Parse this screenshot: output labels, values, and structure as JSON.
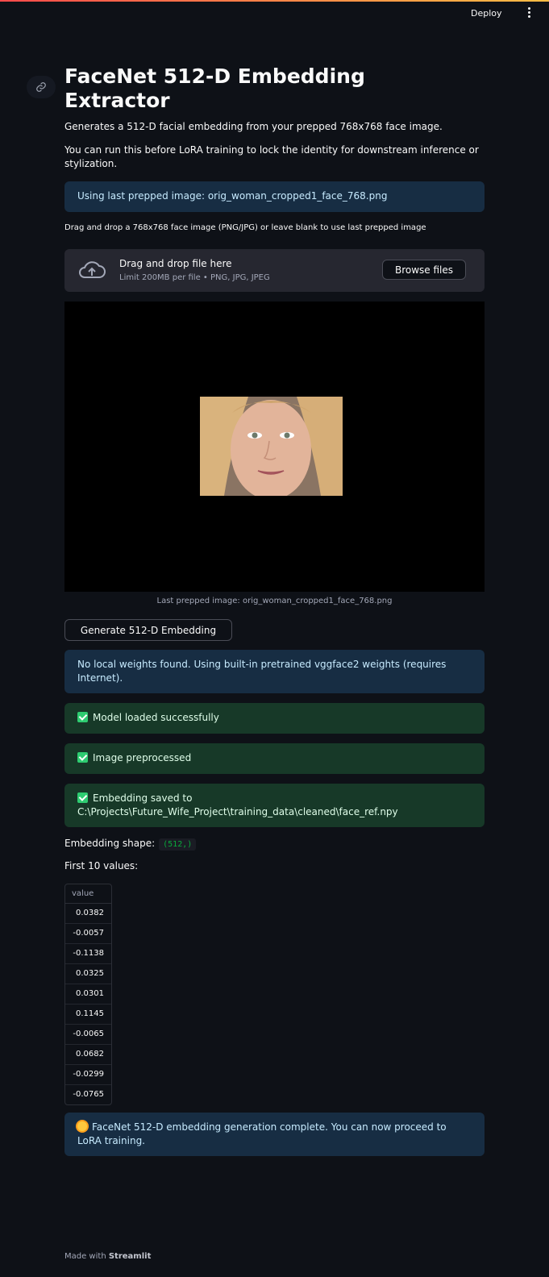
{
  "header": {
    "deploy_label": "Deploy"
  },
  "page": {
    "title": "FaceNet 512-D Embedding Extractor",
    "desc1": "Generates a 512-D facial embedding from your prepped 768x768 face image.",
    "desc2": "You can run this before LoRA training to lock the identity for downstream inference or stylization."
  },
  "alerts": {
    "last_image": "Using last prepped image: orig_woman_cropped1_face_768.png",
    "weights": "No local weights found. Using built-in pretrained vggface2 weights (requires Internet).",
    "model_loaded": "Model loaded successfully",
    "preprocessed": "Image preprocessed",
    "saved": "Embedding saved to C:\\Projects\\Future_Wife_Project\\training_data\\cleaned\\face_ref.npy",
    "complete": "FaceNet 512-D embedding generation complete. You can now proceed to LoRA training."
  },
  "uploader": {
    "label": "Drag and drop a 768x768 face image (PNG/JPG) or leave blank to use last prepped image",
    "main": "Drag and drop file here",
    "sub": "Limit 200MB per file • PNG, JPG, JPEG",
    "browse": "Browse files"
  },
  "image": {
    "caption": "Last prepped image: orig_woman_cropped1_face_768.png"
  },
  "generate_button": "Generate 512-D Embedding",
  "results": {
    "shape_label": "Embedding shape:",
    "shape_value": "(512,)",
    "first10_label": "First 10 values:",
    "column": "value",
    "values": [
      "0.0382",
      "-0.0057",
      "-0.1138",
      "0.0325",
      "0.0301",
      "0.1145",
      "-0.0065",
      "0.0682",
      "-0.0299",
      "-0.0765"
    ]
  },
  "footer": {
    "prefix": "Made with",
    "brand": "Streamlit"
  }
}
